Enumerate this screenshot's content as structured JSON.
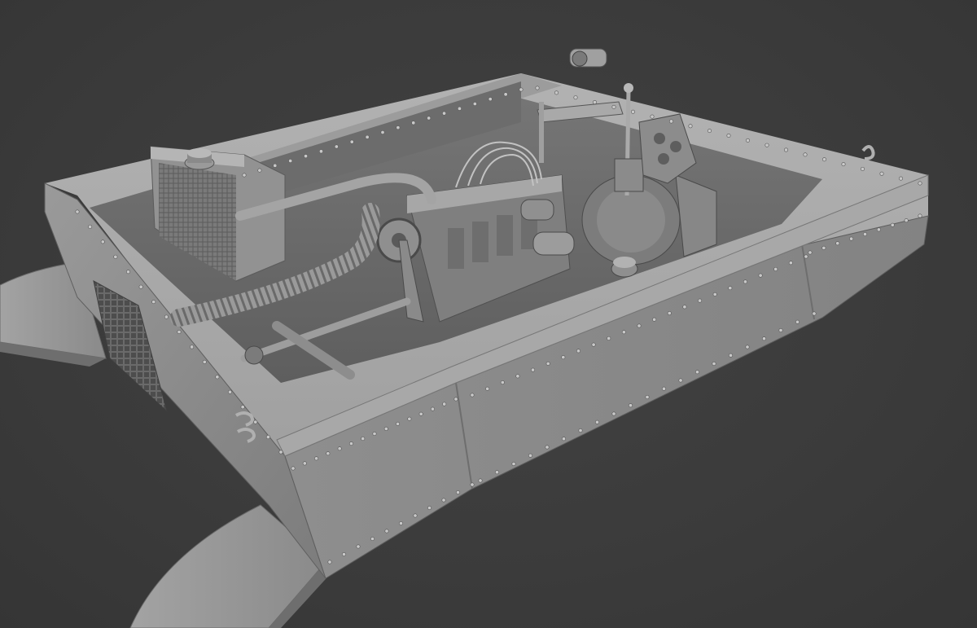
{
  "viewport": {
    "background_color": "#3c3c3c",
    "model_base_color": "#8c8c8c",
    "model_highlight_color": "#b4b4b4",
    "model_shadow_color": "#5a5a5a",
    "model_dark_color": "#2f2f2f"
  },
  "model": {
    "parts": [
      "hull-left-track-guard",
      "hull-right-track-guard",
      "hull-left-side-wall",
      "hull-front-armor-plate",
      "hull-right-side-wall",
      "radiator-housing",
      "radiator-grille",
      "radiator-filler-cap",
      "engine-block",
      "engine-fan-pulley",
      "engine-exhaust-hose",
      "engine-cooling-pipe",
      "engine-wiring-harness",
      "engine-cylinders",
      "generator",
      "gearbox-clutch-housing",
      "gear-lever",
      "instrument-panel",
      "steering-column",
      "drive-shaft",
      "front-ventilation-grille",
      "towing-hooks",
      "headlight-mount",
      "rivets"
    ]
  }
}
